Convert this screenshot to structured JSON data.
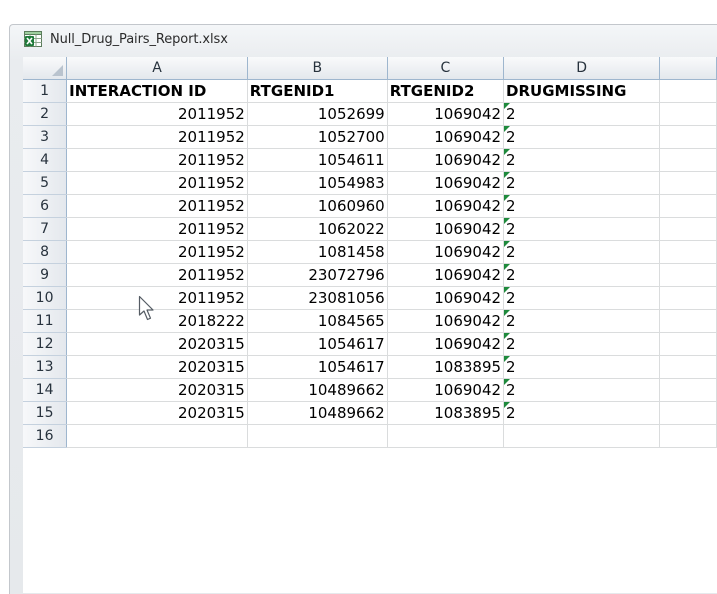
{
  "window": {
    "file_name": "Null_Drug_Pairs_Report.xlsx",
    "app_icon": "excel-file-icon"
  },
  "sheet": {
    "column_letters": [
      "A",
      "B",
      "C",
      "D"
    ],
    "header_row": {
      "row_number": "1",
      "cells": [
        "INTERACTION ID",
        "RTGENID1",
        "RTGENID2",
        "DRUGMISSING"
      ]
    },
    "rows": [
      {
        "row_number": "2",
        "interaction_id": "2011952",
        "rtgenid1": "1052699",
        "rtgenid2": "1069042",
        "drugmissing": "2"
      },
      {
        "row_number": "3",
        "interaction_id": "2011952",
        "rtgenid1": "1052700",
        "rtgenid2": "1069042",
        "drugmissing": "2"
      },
      {
        "row_number": "4",
        "interaction_id": "2011952",
        "rtgenid1": "1054611",
        "rtgenid2": "1069042",
        "drugmissing": "2"
      },
      {
        "row_number": "5",
        "interaction_id": "2011952",
        "rtgenid1": "1054983",
        "rtgenid2": "1069042",
        "drugmissing": "2"
      },
      {
        "row_number": "6",
        "interaction_id": "2011952",
        "rtgenid1": "1060960",
        "rtgenid2": "1069042",
        "drugmissing": "2"
      },
      {
        "row_number": "7",
        "interaction_id": "2011952",
        "rtgenid1": "1062022",
        "rtgenid2": "1069042",
        "drugmissing": "2"
      },
      {
        "row_number": "8",
        "interaction_id": "2011952",
        "rtgenid1": "1081458",
        "rtgenid2": "1069042",
        "drugmissing": "2"
      },
      {
        "row_number": "9",
        "interaction_id": "2011952",
        "rtgenid1": "23072796",
        "rtgenid2": "1069042",
        "drugmissing": "2"
      },
      {
        "row_number": "10",
        "interaction_id": "2011952",
        "rtgenid1": "23081056",
        "rtgenid2": "1069042",
        "drugmissing": "2"
      },
      {
        "row_number": "11",
        "interaction_id": "2018222",
        "rtgenid1": "1084565",
        "rtgenid2": "1069042",
        "drugmissing": "2"
      },
      {
        "row_number": "12",
        "interaction_id": "2020315",
        "rtgenid1": "1054617",
        "rtgenid2": "1069042",
        "drugmissing": "2"
      },
      {
        "row_number": "13",
        "interaction_id": "2020315",
        "rtgenid1": "1054617",
        "rtgenid2": "1083895",
        "drugmissing": "2"
      },
      {
        "row_number": "14",
        "interaction_id": "2020315",
        "rtgenid1": "10489662",
        "rtgenid2": "1069042",
        "drugmissing": "2"
      },
      {
        "row_number": "15",
        "interaction_id": "2020315",
        "rtgenid1": "10489662",
        "rtgenid2": "1083895",
        "drugmissing": "2"
      }
    ],
    "trailing_row_number": "16",
    "text_number_marker_color": "#1e8a3c",
    "header_border_color": "#9eb6ce"
  },
  "pointer": {
    "icon": "mouse-pointer-icon"
  }
}
